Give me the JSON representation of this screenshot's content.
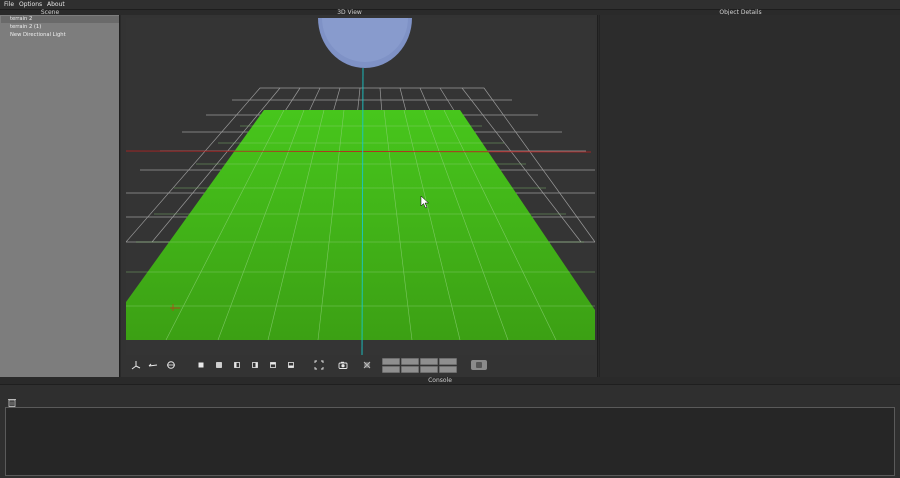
{
  "menubar": {
    "items": [
      {
        "label": "File"
      },
      {
        "label": "Options"
      },
      {
        "label": "About"
      }
    ]
  },
  "panels": {
    "scene_title": "Scene",
    "view_title": "3D View",
    "details_title": "Object Details",
    "console_title": "Console"
  },
  "scene": {
    "items": [
      {
        "label": "terrain 2",
        "selected": true
      },
      {
        "label": "terrain 2 (1)",
        "selected": false
      },
      {
        "label": "New Directional Light",
        "selected": false
      }
    ]
  },
  "viewport": {
    "colors": {
      "background": "#343434",
      "terrain": "#3fb51a",
      "grid": "#a8a8a8",
      "sky_dome": "#7f92c6",
      "axis_y": "#19c6c6",
      "axis_x": "#c02020"
    }
  },
  "toolbar": {
    "icons": [
      "move-axes-icon",
      "rotate-icon",
      "scale-icon",
      "view-front-icon",
      "view-back-icon",
      "view-left-icon",
      "view-right-icon",
      "view-top-icon",
      "view-bottom-icon",
      "fullscreen-icon",
      "camera-icon",
      "grid-toggle-icon"
    ]
  },
  "console": {
    "icons": [
      "trash-icon"
    ]
  }
}
